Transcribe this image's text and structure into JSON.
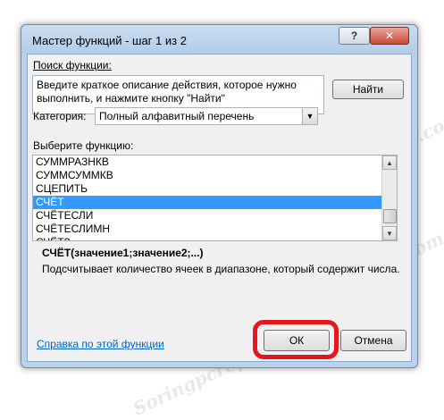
{
  "window": {
    "title": "Мастер функций - шаг 1 из 2",
    "help_glyph": "?",
    "close_glyph": "✕"
  },
  "search": {
    "label": "Поиск функции:",
    "placeholder_text": "Введите краткое описание действия, которое нужно выполнить, и нажмите кнопку \"Найти\"",
    "find_button": "Найти"
  },
  "category": {
    "label": "Категория:",
    "selected": "Полный алфавитный перечень",
    "arrow_glyph": "▼"
  },
  "functions": {
    "label": "Выберите функцию:",
    "items": [
      {
        "name": "СУММРАЗНКВ",
        "selected": false
      },
      {
        "name": "СУММСУММКВ",
        "selected": false
      },
      {
        "name": "СЦЕПИТЬ",
        "selected": false
      },
      {
        "name": "СЧЁТ",
        "selected": true
      },
      {
        "name": "СЧЁТЕСЛИ",
        "selected": false
      },
      {
        "name": "СЧЁТЕСЛИМН",
        "selected": false
      },
      {
        "name": "СЧЁТЗ",
        "selected": false
      }
    ],
    "scroll_up_glyph": "▲",
    "scroll_down_glyph": "▼"
  },
  "details": {
    "signature": "СЧЁТ(значение1;значение2;...)",
    "description": "Подсчитывает количество ячеек в диапазоне, который содержит числа."
  },
  "footer": {
    "help_link": "Справка по этой функции",
    "ok_button": "ОК",
    "cancel_button": "Отмена"
  },
  "watermark": "Soringpcrepair.com",
  "colors": {
    "selection": "#3399ff",
    "highlight_ring": "#e6161d",
    "link": "#0066cc"
  }
}
